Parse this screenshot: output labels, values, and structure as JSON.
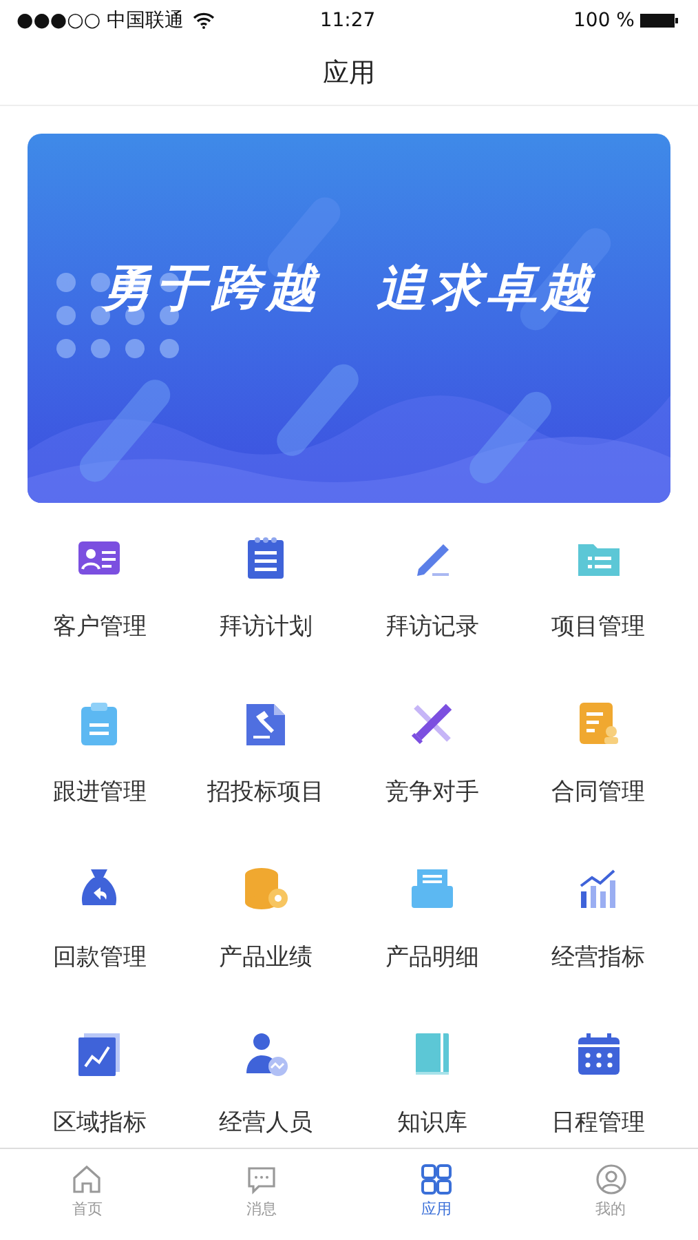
{
  "status_bar": {
    "carrier": "●●●○○ 中国联通",
    "time": "11:27",
    "battery": "100 %"
  },
  "nav": {
    "title": "应用"
  },
  "banner": {
    "kind": "picture",
    "headline": "勇于跨越　追求卓越"
  },
  "apps": [
    {
      "label": "客户管理"
    },
    {
      "label": "拜访计划"
    },
    {
      "label": "拜访记录"
    },
    {
      "label": "项目管理"
    },
    {
      "label": "跟进管理"
    },
    {
      "label": "招投标项目"
    },
    {
      "label": "竞争对手"
    },
    {
      "label": "合同管理"
    },
    {
      "label": "回款管理"
    },
    {
      "label": "产品业绩"
    },
    {
      "label": "产品明细"
    },
    {
      "label": "经营指标"
    },
    {
      "label": "区域指标"
    },
    {
      "label": "经营人员"
    },
    {
      "label": "知识库"
    },
    {
      "label": "日程管理"
    }
  ],
  "tab_bar": [
    {
      "label": "首页",
      "selected": false
    },
    {
      "label": "消息",
      "selected": false
    },
    {
      "label": "应用",
      "selected": true
    },
    {
      "label": "我的",
      "selected": false
    }
  ]
}
